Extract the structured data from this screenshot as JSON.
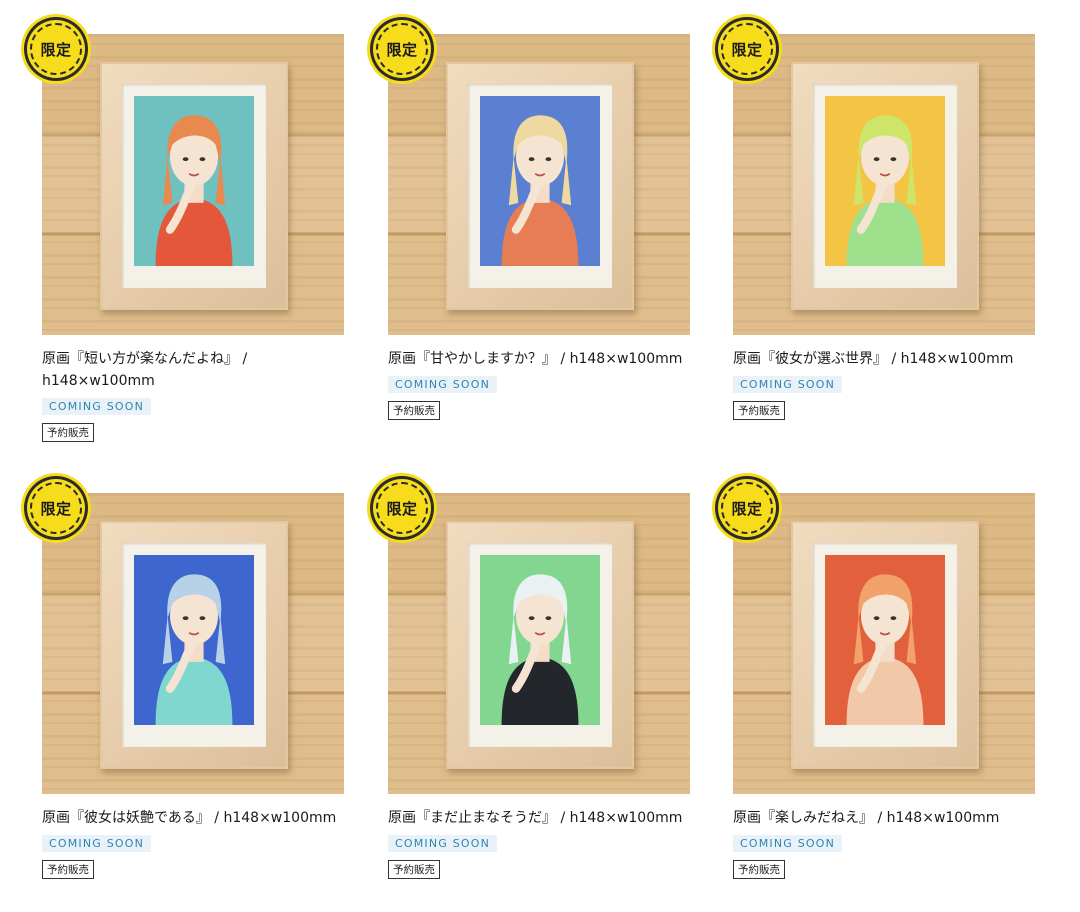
{
  "products": [
    {
      "badge": "限定",
      "title": "原画『短い方が楽なんだよね』 / h148×w100mm",
      "status": "COMING SOON",
      "tag": "予約販売",
      "art_bg": "#6fc1c0",
      "art_accent": "#e4573a",
      "hair": "#e8894f"
    },
    {
      "badge": "限定",
      "title": "原画『甘やかしますか？』 / h148×w100mm",
      "status": "COMING SOON",
      "tag": "予約販売",
      "art_bg": "#5b7fd1",
      "art_accent": "#e77d55",
      "hair": "#f0d9a0"
    },
    {
      "badge": "限定",
      "title": "原画『彼女が選ぶ世界』 / h148×w100mm",
      "status": "COMING SOON",
      "tag": "予約販売",
      "art_bg": "#f4c445",
      "art_accent": "#9fe08c",
      "hair": "#cde66a"
    },
    {
      "badge": "限定",
      "title": "原画『彼女は妖艶である』 / h148×w100mm",
      "status": "COMING SOON",
      "tag": "予約販売",
      "art_bg": "#3d66cf",
      "art_accent": "#7fd7d0",
      "hair": "#b7d2e6"
    },
    {
      "badge": "限定",
      "title": "原画『まだ止まなそうだ』 / h148×w100mm",
      "status": "COMING SOON",
      "tag": "予約販売",
      "art_bg": "#82d68f",
      "art_accent": "#23262a",
      "hair": "#eaf1f2"
    },
    {
      "badge": "限定",
      "title": "原画『楽しみだねえ』 / h148×w100mm",
      "status": "COMING SOON",
      "tag": "予約販売",
      "art_bg": "#e2613c",
      "art_accent": "#f1c9a8",
      "hair": "#f2a16a"
    }
  ]
}
